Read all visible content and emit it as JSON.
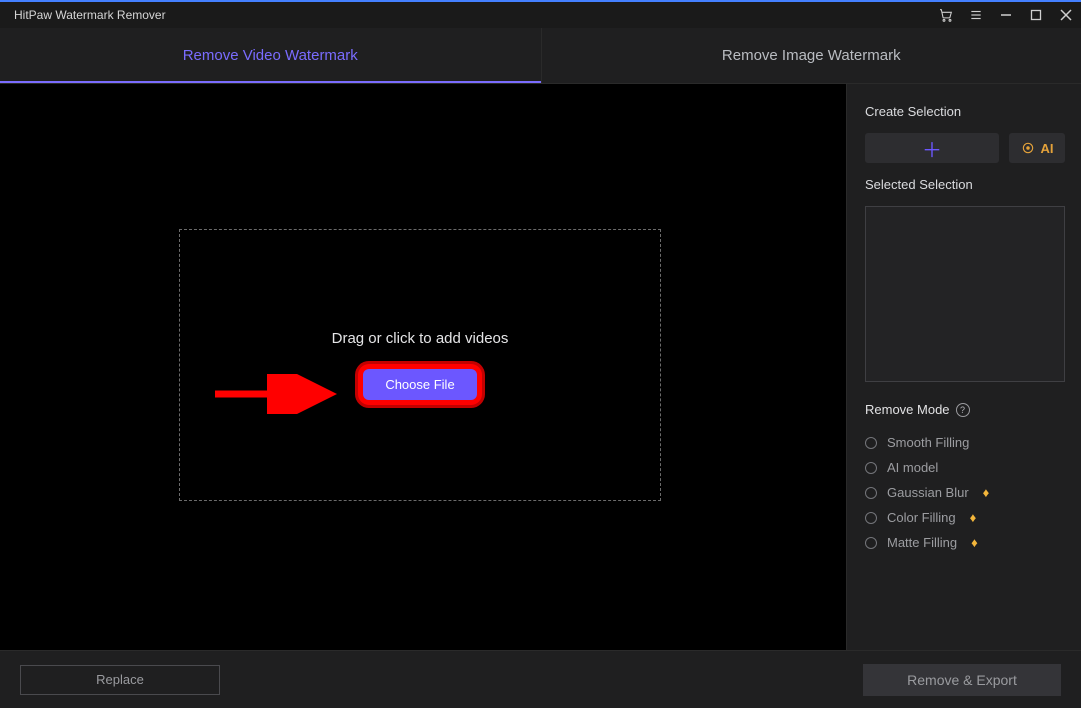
{
  "titlebar": {
    "title": "HitPaw Watermark Remover"
  },
  "tabs": {
    "video": "Remove Video Watermark",
    "image": "Remove Image Watermark"
  },
  "drop": {
    "text": "Drag or click to add videos",
    "button": "Choose File"
  },
  "panel": {
    "create_label": "Create Selection",
    "ai_label": "AI",
    "selected_label": "Selected Selection",
    "mode_label": "Remove Mode",
    "modes": {
      "smooth": "Smooth Filling",
      "ai": "AI model",
      "gauss": "Gaussian Blur",
      "color": "Color Filling",
      "matte": "Matte Filling"
    }
  },
  "footer": {
    "replace": "Replace",
    "export": "Remove & Export"
  }
}
